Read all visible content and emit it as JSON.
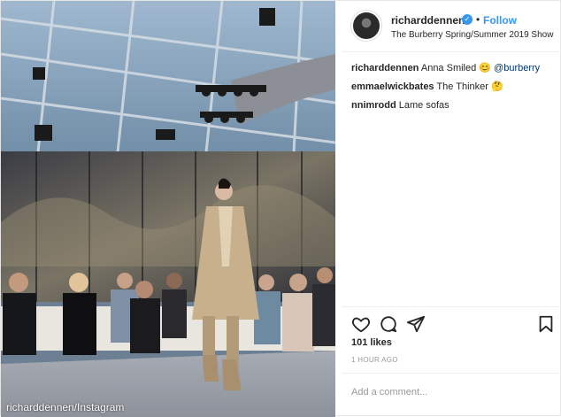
{
  "photo": {
    "alt": "Model on runway at The Burberry Spring/Summer 2019 Show",
    "watermark": "richarddennen/Instagram"
  },
  "header": {
    "username": "richarddennen",
    "follow_label": "Follow",
    "location": "The Burberry Spring/Summer 2019 Show"
  },
  "comments": [
    {
      "user": "richarddennen",
      "text": "Anna Smiled 😊 ",
      "mention": "@burberry"
    },
    {
      "user": "emmaelwickbates",
      "text": "The Thinker 🤔",
      "mention": ""
    },
    {
      "user": "nnimrodd",
      "text": "Lame sofas",
      "mention": ""
    }
  ],
  "actions": {
    "like_icon": "heart-icon",
    "comment_icon": "comment-icon",
    "share_icon": "share-icon",
    "save_icon": "bookmark-icon"
  },
  "likes": "101 likes",
  "time": "1 HOUR AGO",
  "add_comment": {
    "placeholder": "Add a comment..."
  },
  "colors": {
    "accent": "#3897f0",
    "text": "#262626",
    "muted": "#999999"
  }
}
